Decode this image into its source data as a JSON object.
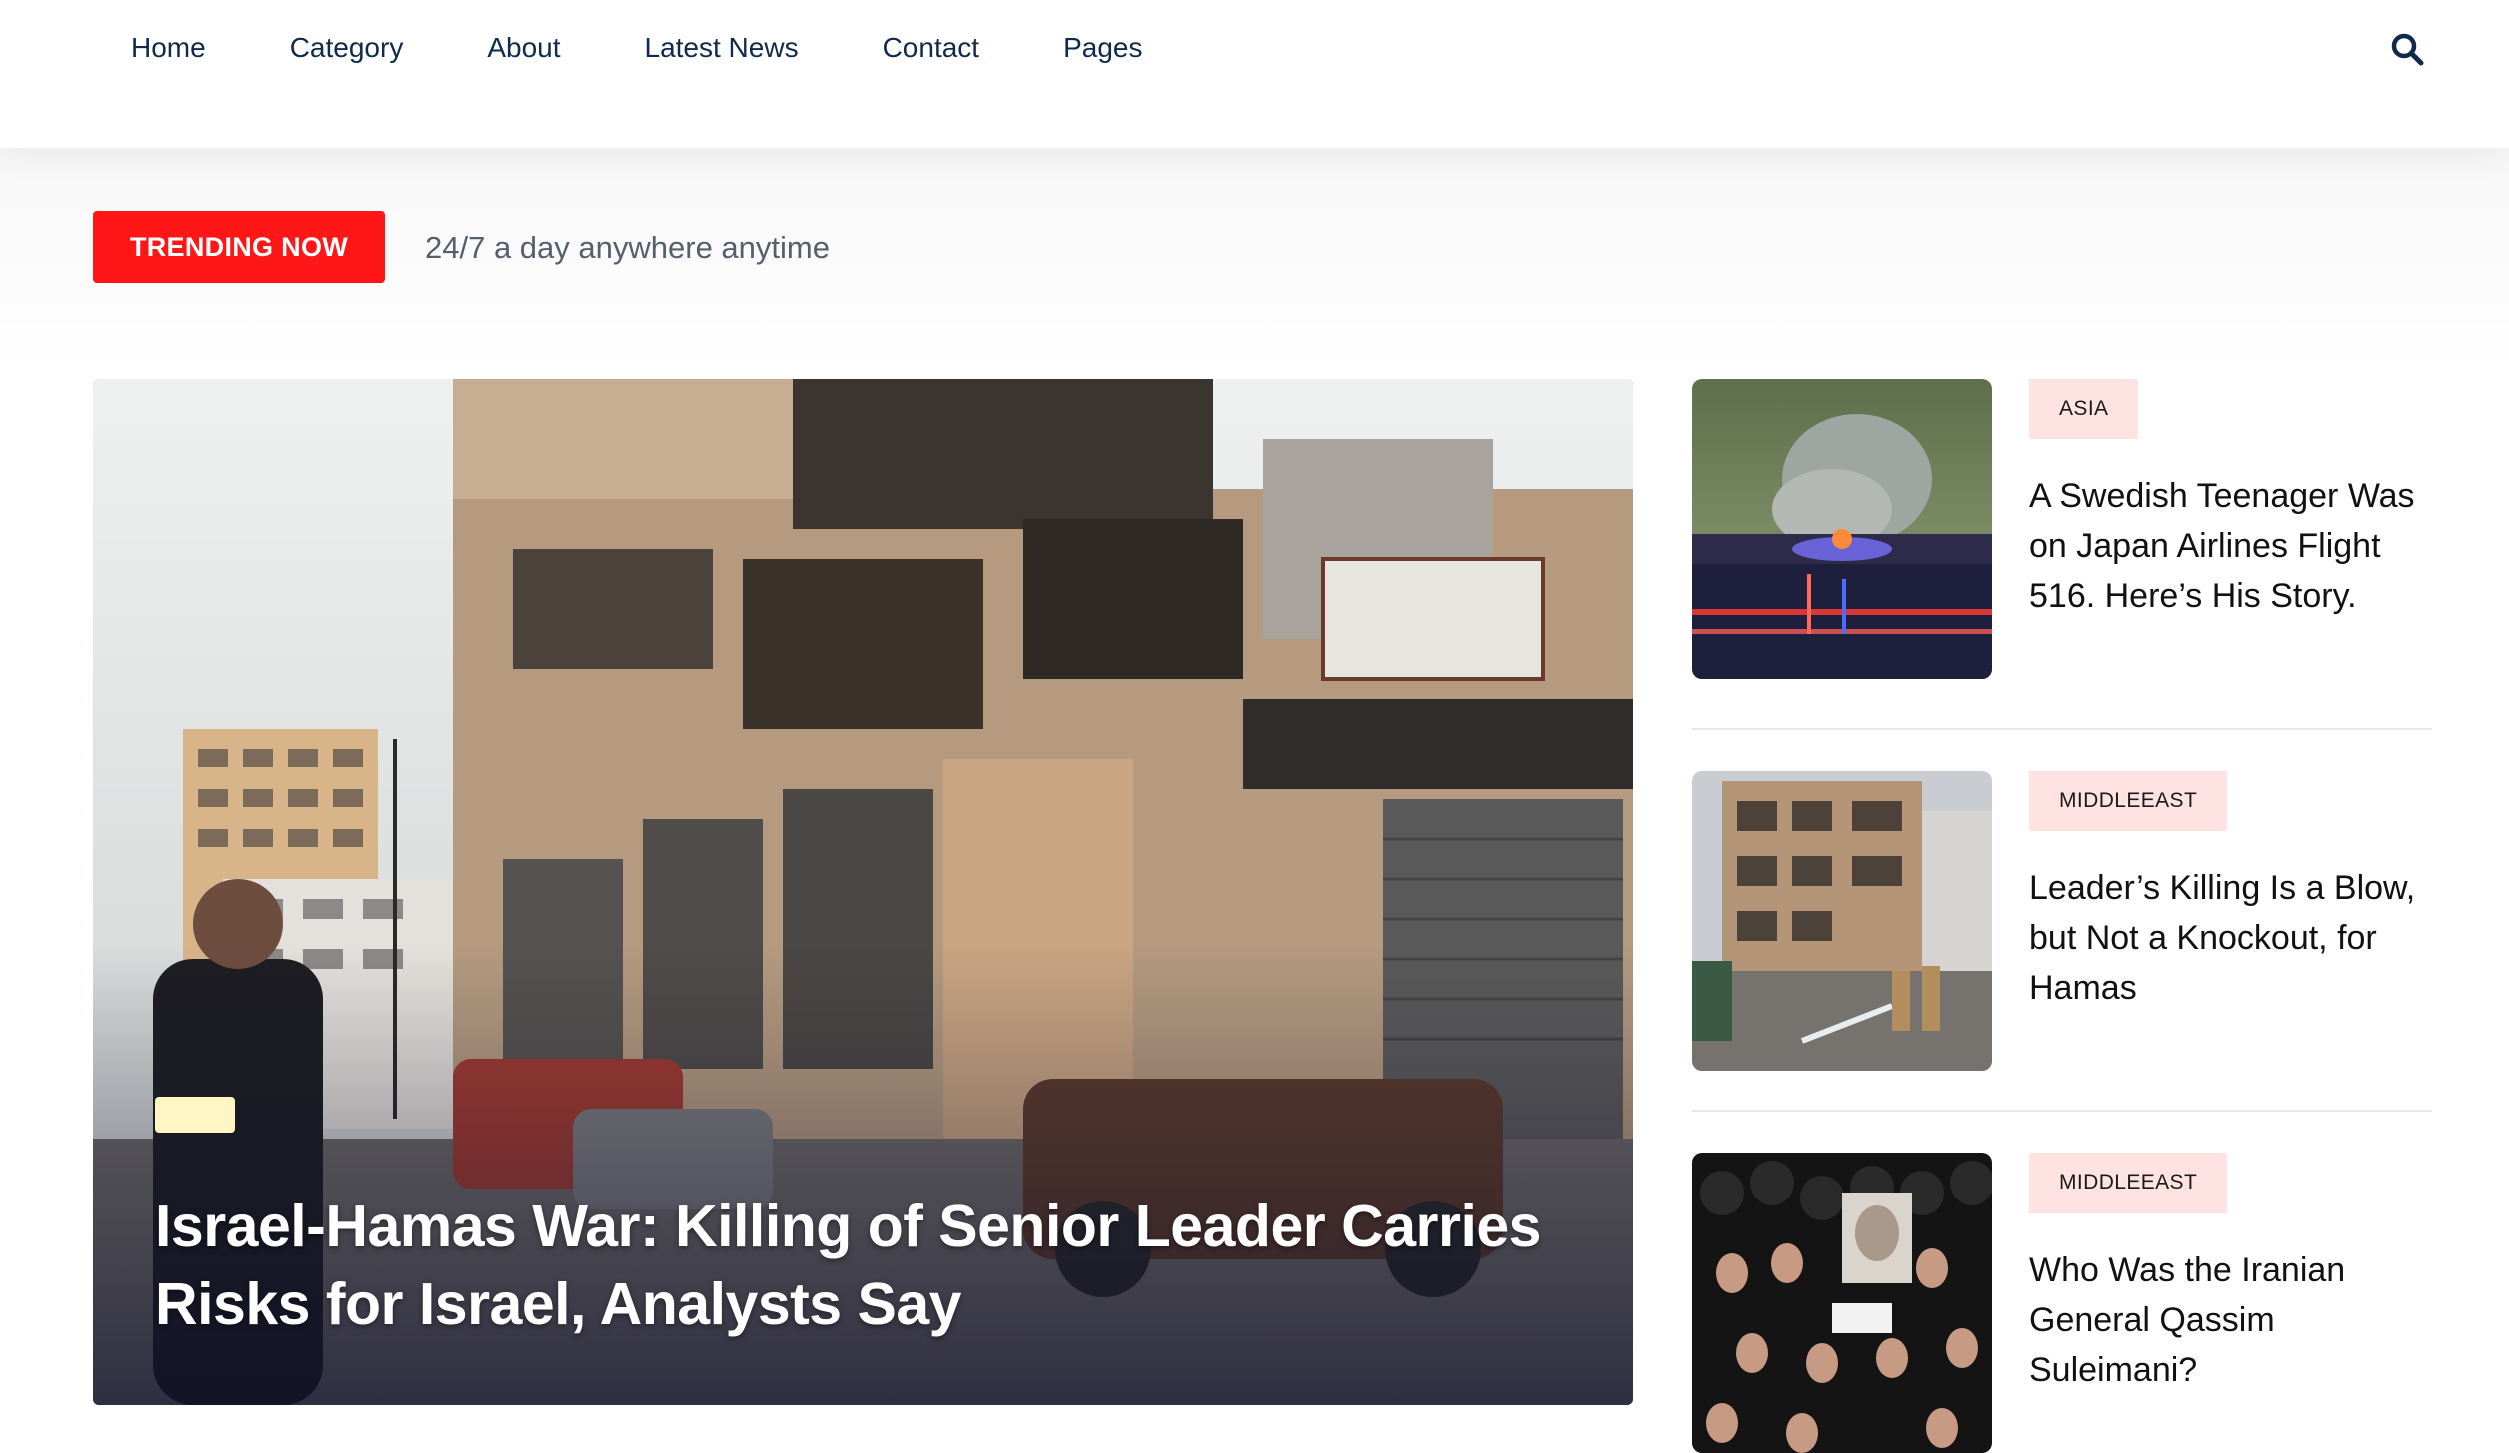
{
  "nav": {
    "items": [
      "Home",
      "Category",
      "About",
      "Latest News",
      "Contact",
      "Pages"
    ]
  },
  "header": {
    "search_icon": "search-icon"
  },
  "trending": {
    "label": "TRENDING NOW",
    "text": "24/7 a day anywhere anytime"
  },
  "hero": {
    "title": "Israel-Hamas War: Killing of Senior Leader Carries Risks for Israel, Analysts Say",
    "badge_color": "#fff6c4"
  },
  "posts": [
    {
      "category": "ASIA",
      "title": "A Swedish Teenager Was on Japan Airlines Flight 516. Here’s His Story."
    },
    {
      "category": "MIDDLEEAST",
      "title": "Leader’s Killing Is a Blow, but Not a Knockout, for Hamas"
    },
    {
      "category": "MIDDLEEAST",
      "title": "Who Was the Iranian General Qassim Suleimani?"
    }
  ],
  "colors": {
    "nav_text": "#0f2a4a",
    "trending_button": "#ff1616",
    "category_badge": "#ffe3e3",
    "title_text": "#111111"
  }
}
